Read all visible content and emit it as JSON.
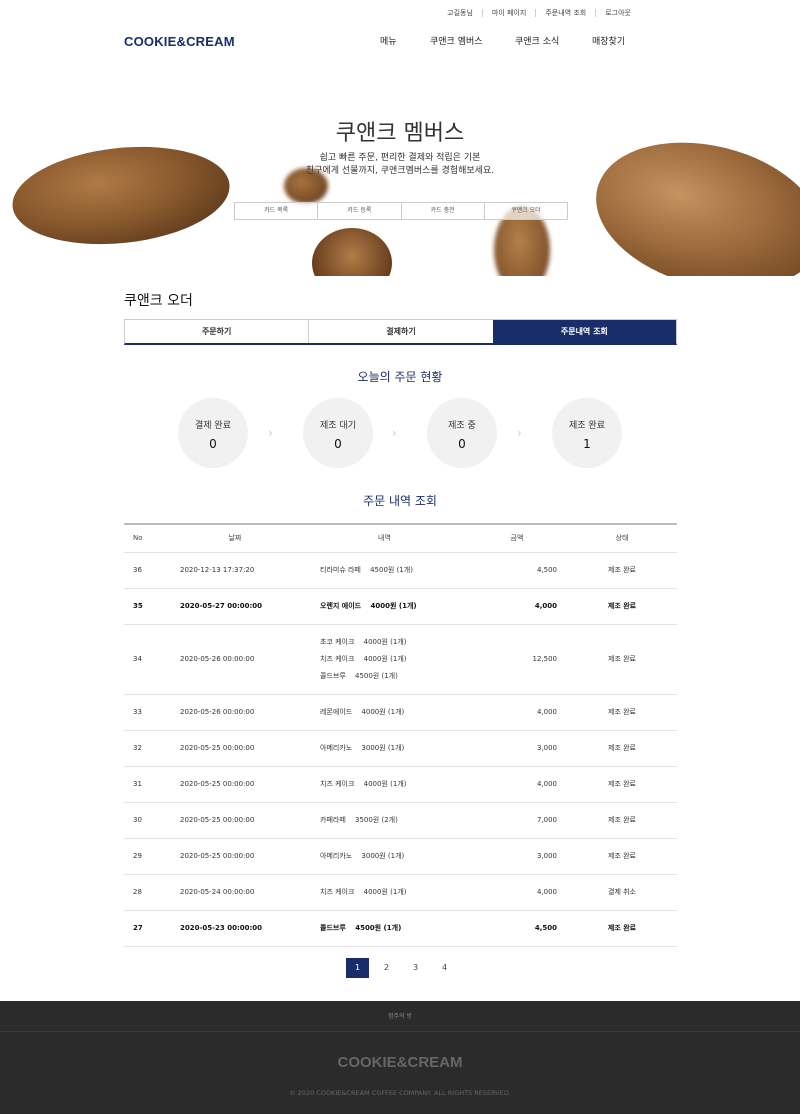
{
  "util_links": [
    "고길동님",
    "마이 페이지",
    "주문내역 조회",
    "로그아웃"
  ],
  "logo": "COOKIE&CREAM",
  "nav": [
    "메뉴",
    "쿠앤크 멤버스",
    "쿠앤크 소식",
    "매장찾기"
  ],
  "hero": {
    "title": "쿠앤크 멤버스",
    "desc1": "쉽고 빠른 주문, 편리한 결제와 적립은 기본",
    "desc2": "친구에게 선물까지, 쿠앤크멤버스를 경험해보세요.",
    "tabs": [
      "카드 목록",
      "카드 등록",
      "카드 충전",
      "쿠앤크 오더"
    ]
  },
  "section_title": "쿠앤크 오더",
  "tabs": [
    "주문하기",
    "결제하기",
    "주문내역 조회"
  ],
  "today_title": "오늘의 주문 현황",
  "status": [
    {
      "label": "결제 완료",
      "value": "0"
    },
    {
      "label": "제조 대기",
      "value": "0"
    },
    {
      "label": "제조 중",
      "value": "0"
    },
    {
      "label": "제조 완료",
      "value": "1"
    }
  ],
  "history_title": "주문 내역 조회",
  "table": {
    "headers": [
      "No",
      "날짜",
      "내역",
      "금액",
      "상태"
    ],
    "rows": [
      {
        "no": "36",
        "date": "2020-12-13 17:37:20",
        "items": [
          "티라미슈 라떼 　4500원 (1개)"
        ],
        "amount": "4,500",
        "status": "제조 완료",
        "bold": false
      },
      {
        "no": "35",
        "date": "2020-05-27 00:00:00",
        "items": [
          "오렌지 에이드 　4000원 (1개)"
        ],
        "amount": "4,000",
        "status": "제조 완료",
        "bold": true
      },
      {
        "no": "34",
        "date": "2020-05-26 00:00:00",
        "items": [
          "초코 케이크 　4000원 (1개)",
          "치즈 케이크 　4000원 (1개)",
          "콜드브루 　4500원 (1개)"
        ],
        "amount": "12,500",
        "status": "제조 완료",
        "bold": false
      },
      {
        "no": "33",
        "date": "2020-05-26 00:00:00",
        "items": [
          "레몬에이드 　4000원 (1개)"
        ],
        "amount": "4,000",
        "status": "제조 완료",
        "bold": false
      },
      {
        "no": "32",
        "date": "2020-05-25 00:00:00",
        "items": [
          "아메리카노 　3000원 (1개)"
        ],
        "amount": "3,000",
        "status": "제조 완료",
        "bold": false
      },
      {
        "no": "31",
        "date": "2020-05-25 00:00:00",
        "items": [
          "치즈 케이크 　4000원 (1개)"
        ],
        "amount": "4,000",
        "status": "제조 완료",
        "bold": false
      },
      {
        "no": "30",
        "date": "2020-05-25 00:00:00",
        "items": [
          "카페라떼 　3500원 (2개)"
        ],
        "amount": "7,000",
        "status": "제조 완료",
        "bold": false
      },
      {
        "no": "29",
        "date": "2020-05-25 00:00:00",
        "items": [
          "아메리카노 　3000원 (1개)"
        ],
        "amount": "3,000",
        "status": "제조 완료",
        "bold": false
      },
      {
        "no": "28",
        "date": "2020-05-24 00:00:00",
        "items": [
          "치즈 케이크 　4000원 (1개)"
        ],
        "amount": "4,000",
        "status": "결제 취소",
        "bold": false
      },
      {
        "no": "27",
        "date": "2020-05-23 00:00:00",
        "items": [
          "콜드브루 　4500원 (1개)"
        ],
        "amount": "4,500",
        "status": "제조 완료",
        "bold": true
      }
    ]
  },
  "pages": [
    "1",
    "2",
    "3",
    "4"
  ],
  "footer": {
    "link": "점주의 방",
    "logo": "COOKIE&CREAM",
    "copy": "© 2020 COOKIE&CREAM COFFEE COMPANY. ALL RIGHTS RESERVED."
  },
  "colors": {
    "brand": "#1a2d6b",
    "footer_bg": "#2b2b2b"
  }
}
